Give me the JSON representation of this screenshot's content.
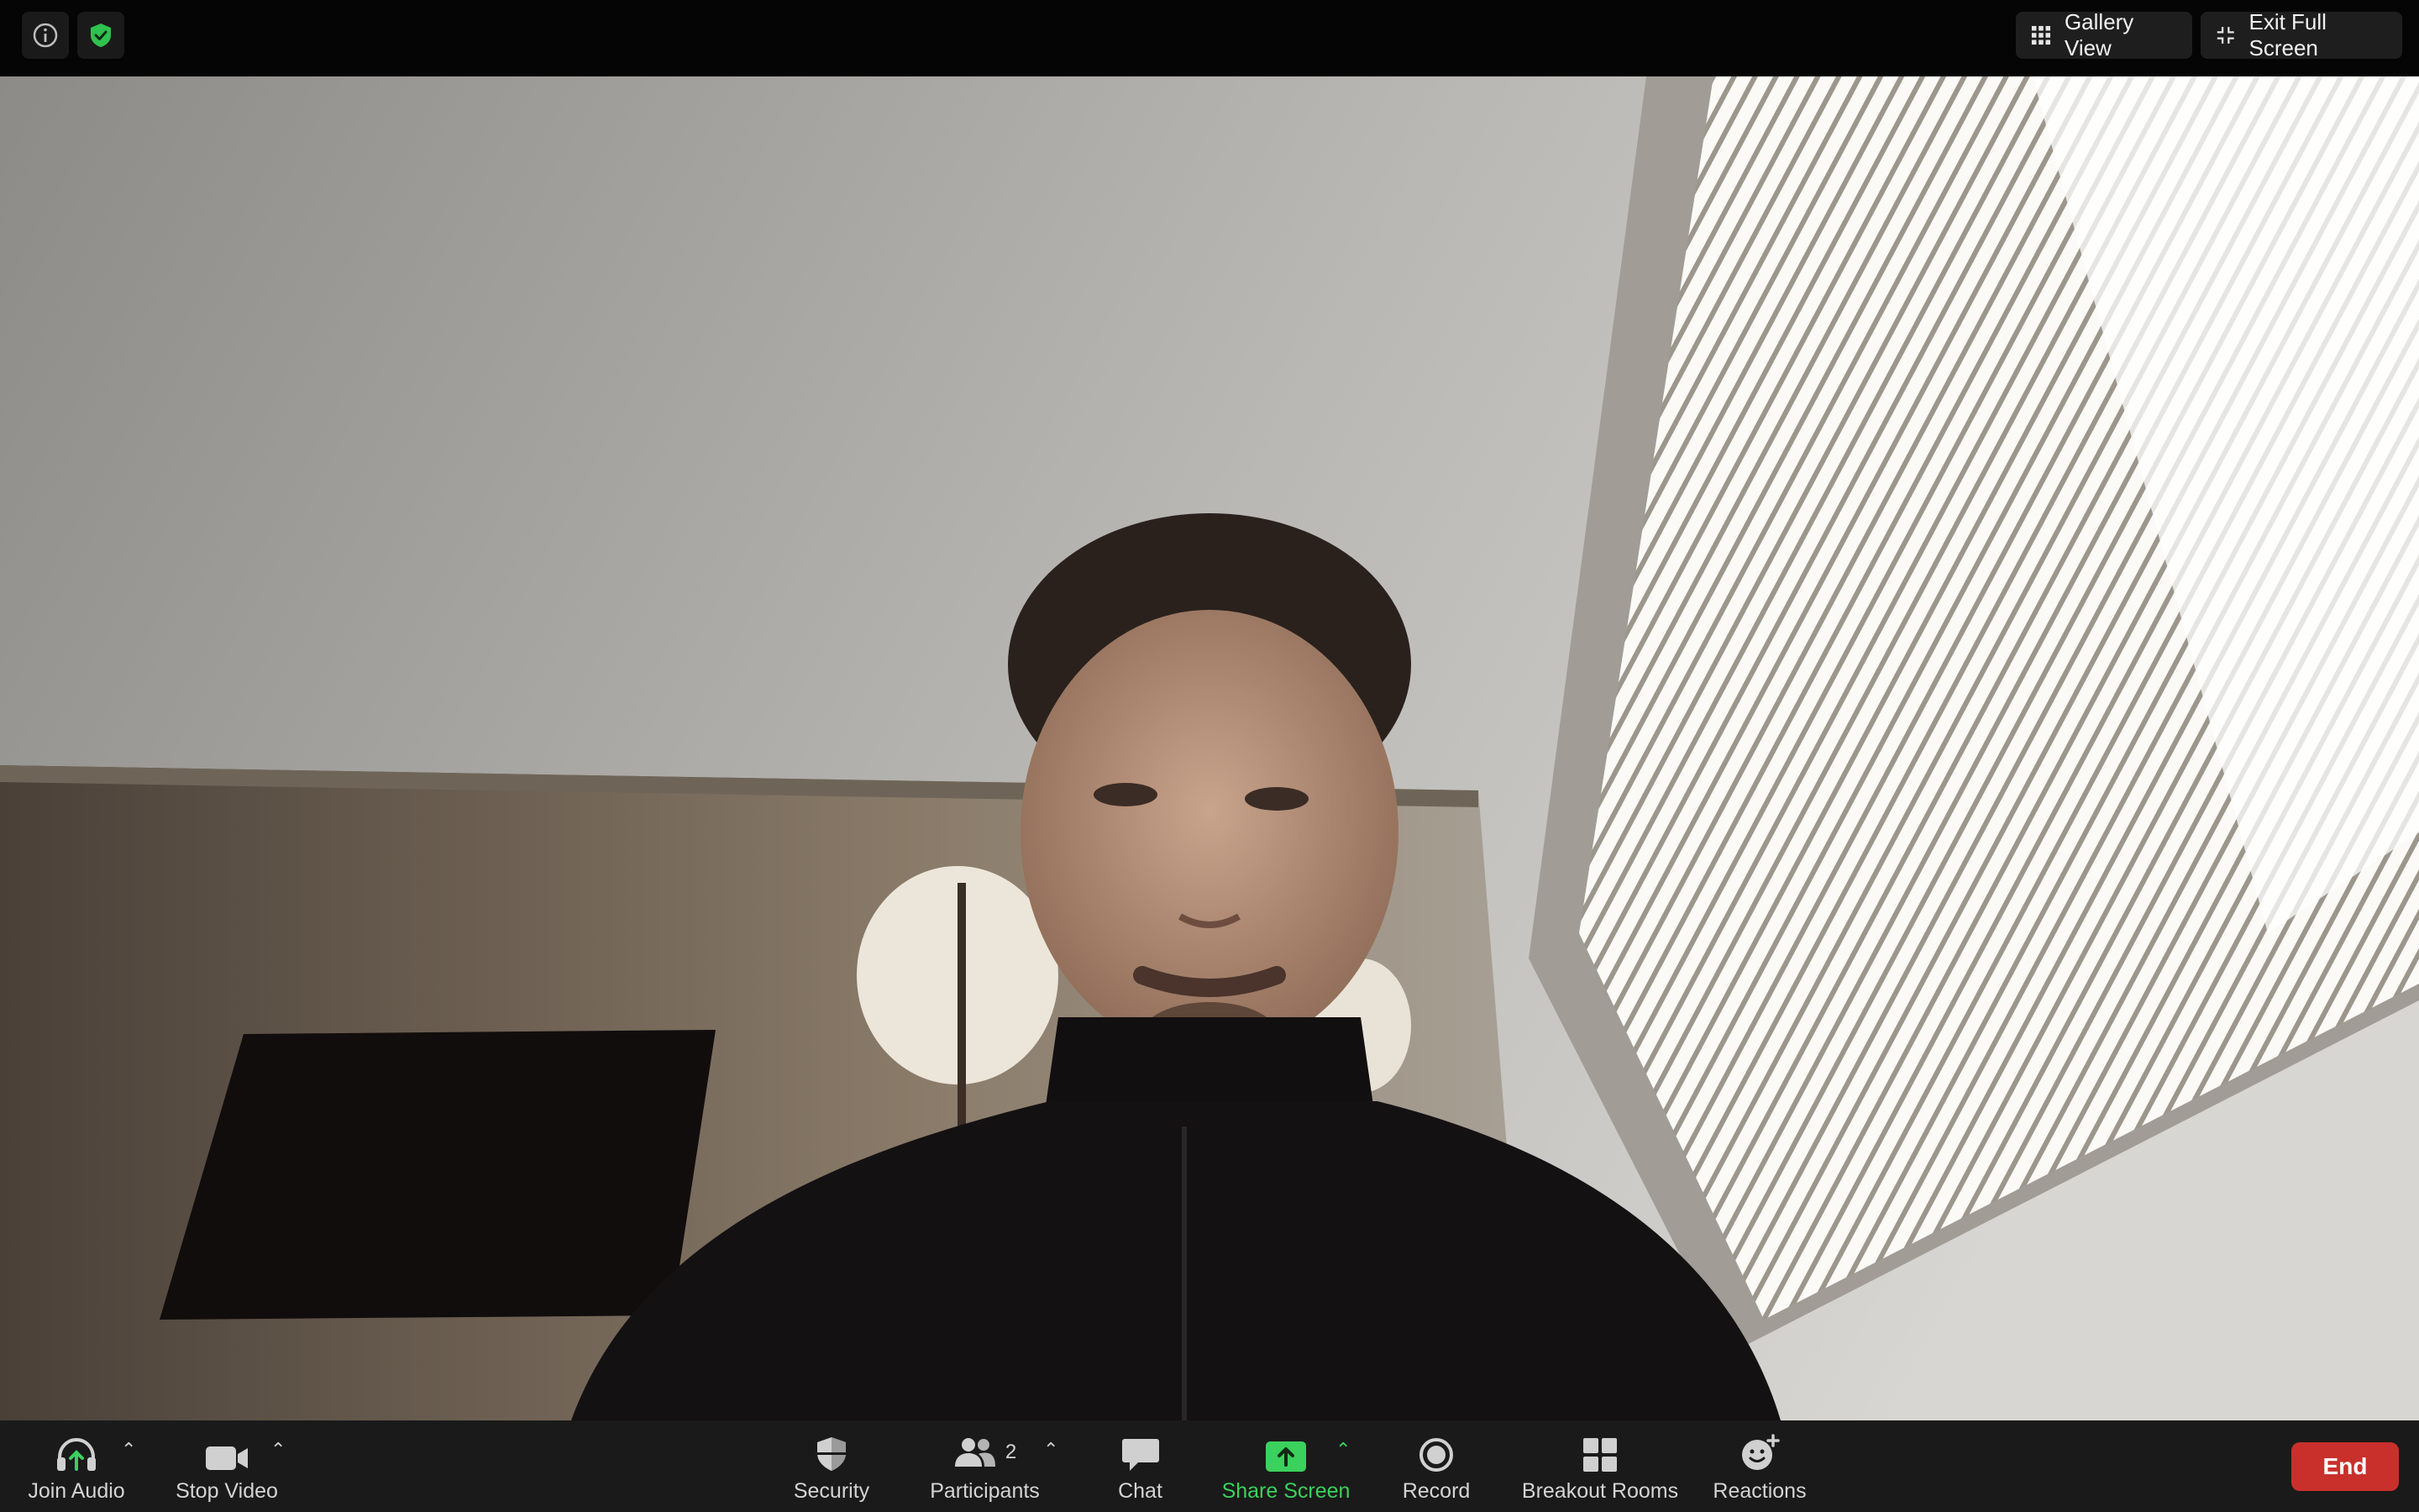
{
  "topbar": {
    "info_icon": "info-icon",
    "security_icon": "shield-check-icon",
    "gallery_view_label": "Gallery View",
    "exit_full_screen_label": "Exit Full Screen"
  },
  "toolbar": {
    "join_audio_label": "Join Audio",
    "stop_video_label": "Stop Video",
    "security_label": "Security",
    "participants_label": "Participants",
    "participants_count": "2",
    "chat_label": "Chat",
    "share_screen_label": "Share Screen",
    "record_label": "Record",
    "breakout_rooms_label": "Breakout Rooms",
    "reactions_label": "Reactions",
    "end_label": "End"
  },
  "colors": {
    "share_green": "#3ad15c",
    "end_red": "#c9302c",
    "toolbar_bg": "#1a1a1a"
  }
}
